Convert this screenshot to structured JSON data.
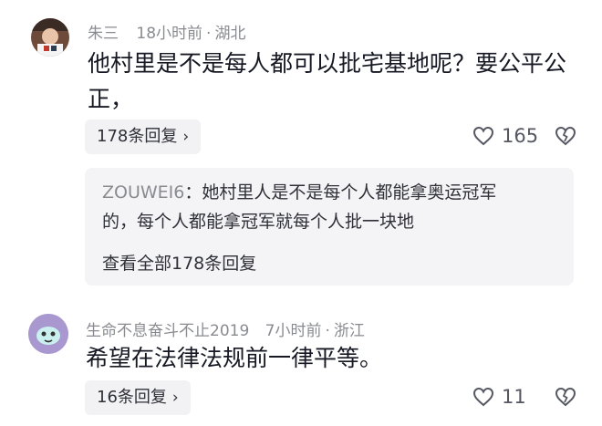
{
  "comments": [
    {
      "username": "朱三",
      "time": "18小时前",
      "location": "湖北",
      "text_line1": "他村里是不是每人都可以批宅基地呢？要公平公",
      "text_line2": "正，",
      "replies_label": "178条回复",
      "likes": "165",
      "reply_preview": {
        "author": "ZOUWEI6",
        "line1": "：她村里人是不是每个人都能拿奥运冠军",
        "line2": "的，每个人都能拿冠军就每个人批一块地"
      },
      "view_all_label": "查看全部178条回复"
    },
    {
      "username": "生命不息奋斗不止2019",
      "time": "7小时前",
      "location": "浙江",
      "text": "希望在法律法规前一律平等。",
      "replies_label": "16条回复",
      "likes": "11"
    }
  ],
  "colors": {
    "meta": "#8a8b91",
    "text": "#161823",
    "pill_bg": "#f2f2f4"
  },
  "icons": {
    "like": "heart-outline-icon",
    "dislike": "broken-heart-icon",
    "more": "chevron-right-icon"
  }
}
